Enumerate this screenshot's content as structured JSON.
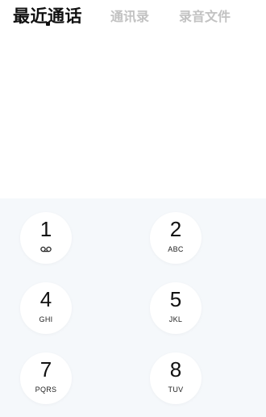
{
  "tabs": {
    "recent_calls": "最近通话",
    "contacts": "通讯录",
    "recordings": "录音文件"
  },
  "dialpad": {
    "keys": [
      {
        "digit": "1",
        "letters": "",
        "icon": "voicemail-icon"
      },
      {
        "digit": "2",
        "letters": "ABC"
      },
      {
        "digit": "4",
        "letters": "GHI"
      },
      {
        "digit": "5",
        "letters": "JKL"
      },
      {
        "digit": "7",
        "letters": "PQRS"
      },
      {
        "digit": "8",
        "letters": "TUV"
      }
    ]
  },
  "colors": {
    "active_tab": "#111111",
    "inactive_tab": "#c2c2c2",
    "dialpad_bg": "#f5f8fb",
    "key_bg": "#ffffff"
  }
}
